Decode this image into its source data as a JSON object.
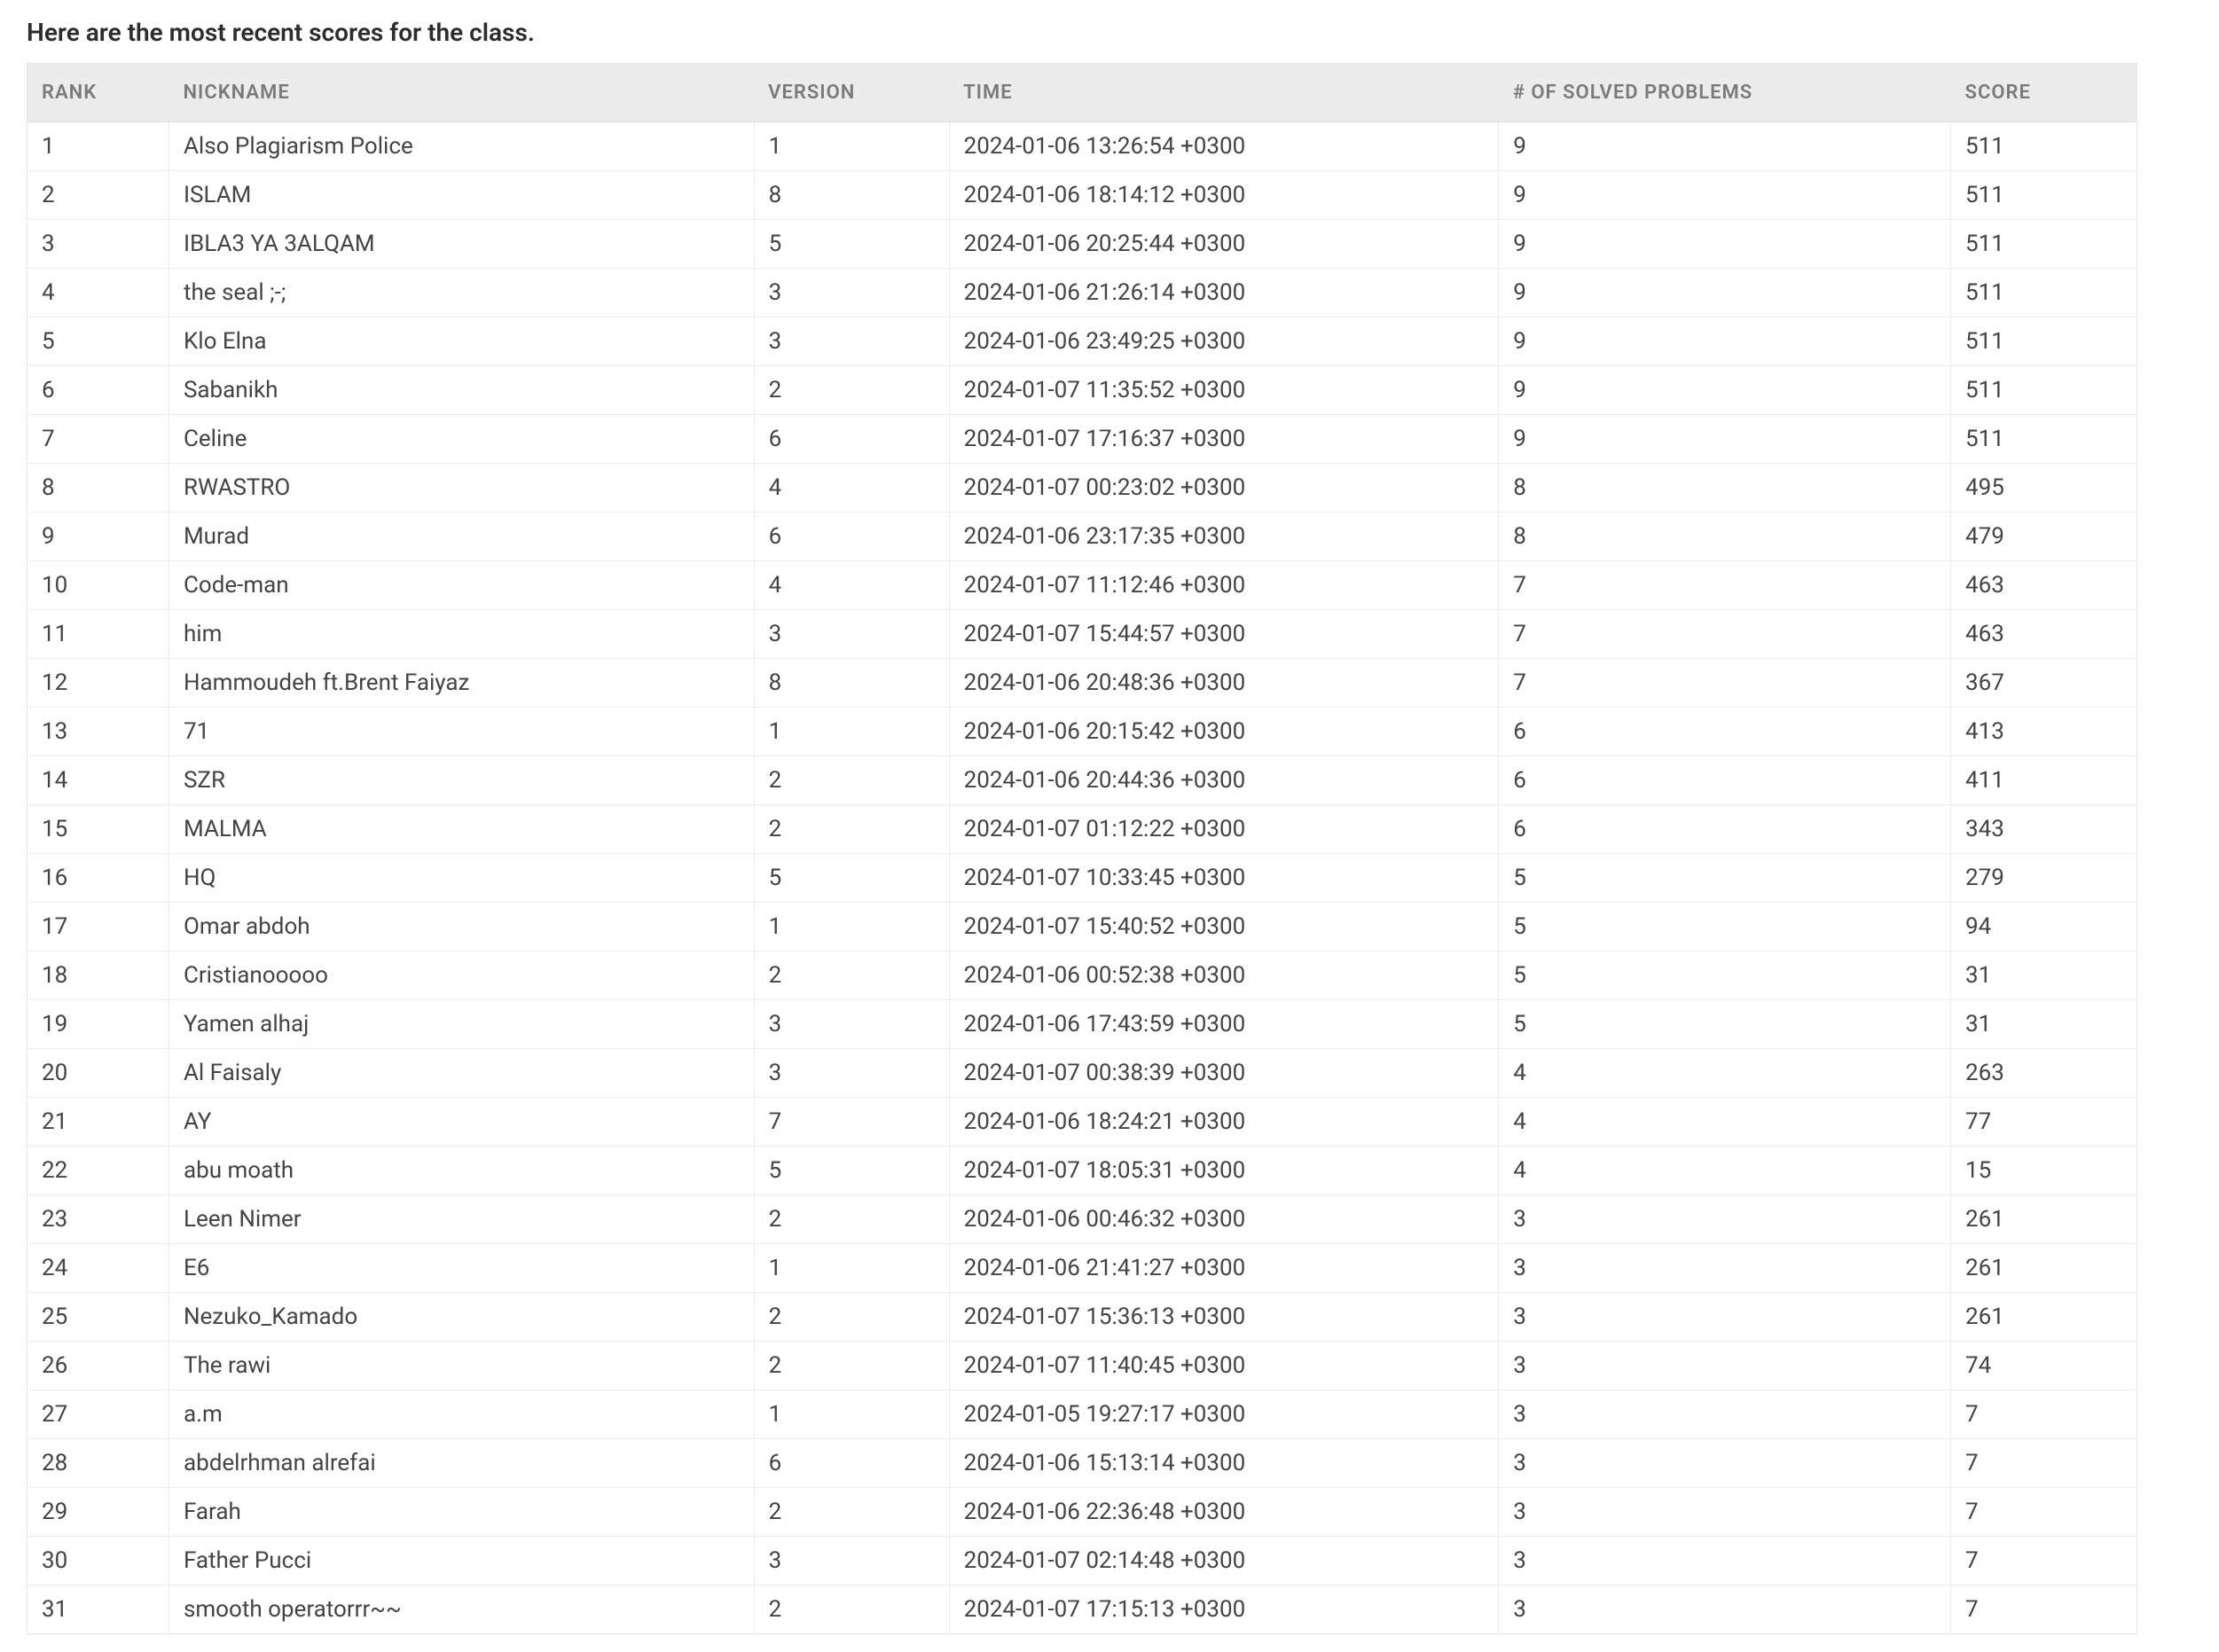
{
  "page_title": "Here are the most recent scores for the class.",
  "table": {
    "headers": {
      "rank": "RANK",
      "nickname": "NICKNAME",
      "version": "VERSION",
      "time": "TIME",
      "solved": "# OF SOLVED PROBLEMS",
      "score": "SCORE"
    },
    "rows": [
      {
        "rank": "1",
        "nickname": "Also Plagiarism Police",
        "version": "1",
        "time": "2024-01-06 13:26:54 +0300",
        "solved": "9",
        "score": "511"
      },
      {
        "rank": "2",
        "nickname": "ISLAM",
        "version": "8",
        "time": "2024-01-06 18:14:12 +0300",
        "solved": "9",
        "score": "511"
      },
      {
        "rank": "3",
        "nickname": "IBLA3 YA 3ALQAM",
        "version": "5",
        "time": "2024-01-06 20:25:44 +0300",
        "solved": "9",
        "score": "511"
      },
      {
        "rank": "4",
        "nickname": "the seal ;-;",
        "version": "3",
        "time": "2024-01-06 21:26:14 +0300",
        "solved": "9",
        "score": "511"
      },
      {
        "rank": "5",
        "nickname": "Klo Elna",
        "version": "3",
        "time": "2024-01-06 23:49:25 +0300",
        "solved": "9",
        "score": "511"
      },
      {
        "rank": "6",
        "nickname": "Sabanikh",
        "version": "2",
        "time": "2024-01-07 11:35:52 +0300",
        "solved": "9",
        "score": "511"
      },
      {
        "rank": "7",
        "nickname": "Celine",
        "version": "6",
        "time": "2024-01-07 17:16:37 +0300",
        "solved": "9",
        "score": "511"
      },
      {
        "rank": "8",
        "nickname": "RWASTRO",
        "version": "4",
        "time": "2024-01-07 00:23:02 +0300",
        "solved": "8",
        "score": "495"
      },
      {
        "rank": "9",
        "nickname": "Murad",
        "version": "6",
        "time": "2024-01-06 23:17:35 +0300",
        "solved": "8",
        "score": "479"
      },
      {
        "rank": "10",
        "nickname": "Code-man",
        "version": "4",
        "time": "2024-01-07 11:12:46 +0300",
        "solved": "7",
        "score": "463"
      },
      {
        "rank": "11",
        "nickname": "him",
        "version": "3",
        "time": "2024-01-07 15:44:57 +0300",
        "solved": "7",
        "score": "463"
      },
      {
        "rank": "12",
        "nickname": "Hammoudeh ft.Brent Faiyaz",
        "version": "8",
        "time": "2024-01-06 20:48:36 +0300",
        "solved": "7",
        "score": "367"
      },
      {
        "rank": "13",
        "nickname": "71",
        "version": "1",
        "time": "2024-01-06 20:15:42 +0300",
        "solved": "6",
        "score": "413"
      },
      {
        "rank": "14",
        "nickname": "SZR",
        "version": "2",
        "time": "2024-01-06 20:44:36 +0300",
        "solved": "6",
        "score": "411"
      },
      {
        "rank": "15",
        "nickname": "MALMA",
        "version": "2",
        "time": "2024-01-07 01:12:22 +0300",
        "solved": "6",
        "score": "343"
      },
      {
        "rank": "16",
        "nickname": "HQ",
        "version": "5",
        "time": "2024-01-07 10:33:45 +0300",
        "solved": "5",
        "score": "279"
      },
      {
        "rank": "17",
        "nickname": "Omar abdoh",
        "version": "1",
        "time": "2024-01-07 15:40:52 +0300",
        "solved": "5",
        "score": "94"
      },
      {
        "rank": "18",
        "nickname": "Cristianooooo",
        "version": "2",
        "time": "2024-01-06 00:52:38 +0300",
        "solved": "5",
        "score": "31"
      },
      {
        "rank": "19",
        "nickname": "Yamen alhaj",
        "version": "3",
        "time": "2024-01-06 17:43:59 +0300",
        "solved": "5",
        "score": "31"
      },
      {
        "rank": "20",
        "nickname": "Al Faisaly",
        "version": "3",
        "time": "2024-01-07 00:38:39 +0300",
        "solved": "4",
        "score": "263"
      },
      {
        "rank": "21",
        "nickname": "AY",
        "version": "7",
        "time": "2024-01-06 18:24:21 +0300",
        "solved": "4",
        "score": "77"
      },
      {
        "rank": "22",
        "nickname": "abu moath",
        "version": "5",
        "time": "2024-01-07 18:05:31 +0300",
        "solved": "4",
        "score": "15"
      },
      {
        "rank": "23",
        "nickname": "Leen Nimer",
        "version": "2",
        "time": "2024-01-06 00:46:32 +0300",
        "solved": "3",
        "score": "261"
      },
      {
        "rank": "24",
        "nickname": "E6",
        "version": "1",
        "time": "2024-01-06 21:41:27 +0300",
        "solved": "3",
        "score": "261"
      },
      {
        "rank": "25",
        "nickname": "Nezuko_Kamado",
        "version": "2",
        "time": "2024-01-07 15:36:13 +0300",
        "solved": "3",
        "score": "261"
      },
      {
        "rank": "26",
        "nickname": "The rawi",
        "version": "2",
        "time": "2024-01-07 11:40:45 +0300",
        "solved": "3",
        "score": "74"
      },
      {
        "rank": "27",
        "nickname": "a.m",
        "version": "1",
        "time": "2024-01-05 19:27:17 +0300",
        "solved": "3",
        "score": "7"
      },
      {
        "rank": "28",
        "nickname": "abdelrhman alrefai",
        "version": "6",
        "time": "2024-01-06 15:13:14 +0300",
        "solved": "3",
        "score": "7"
      },
      {
        "rank": "29",
        "nickname": "Farah",
        "version": "2",
        "time": "2024-01-06 22:36:48 +0300",
        "solved": "3",
        "score": "7"
      },
      {
        "rank": "30",
        "nickname": "Father Pucci",
        "version": "3",
        "time": "2024-01-07 02:14:48 +0300",
        "solved": "3",
        "score": "7"
      },
      {
        "rank": "31",
        "nickname": "smooth operatorrr~~",
        "version": "2",
        "time": "2024-01-07 17:15:13 +0300",
        "solved": "3",
        "score": "7"
      }
    ]
  }
}
